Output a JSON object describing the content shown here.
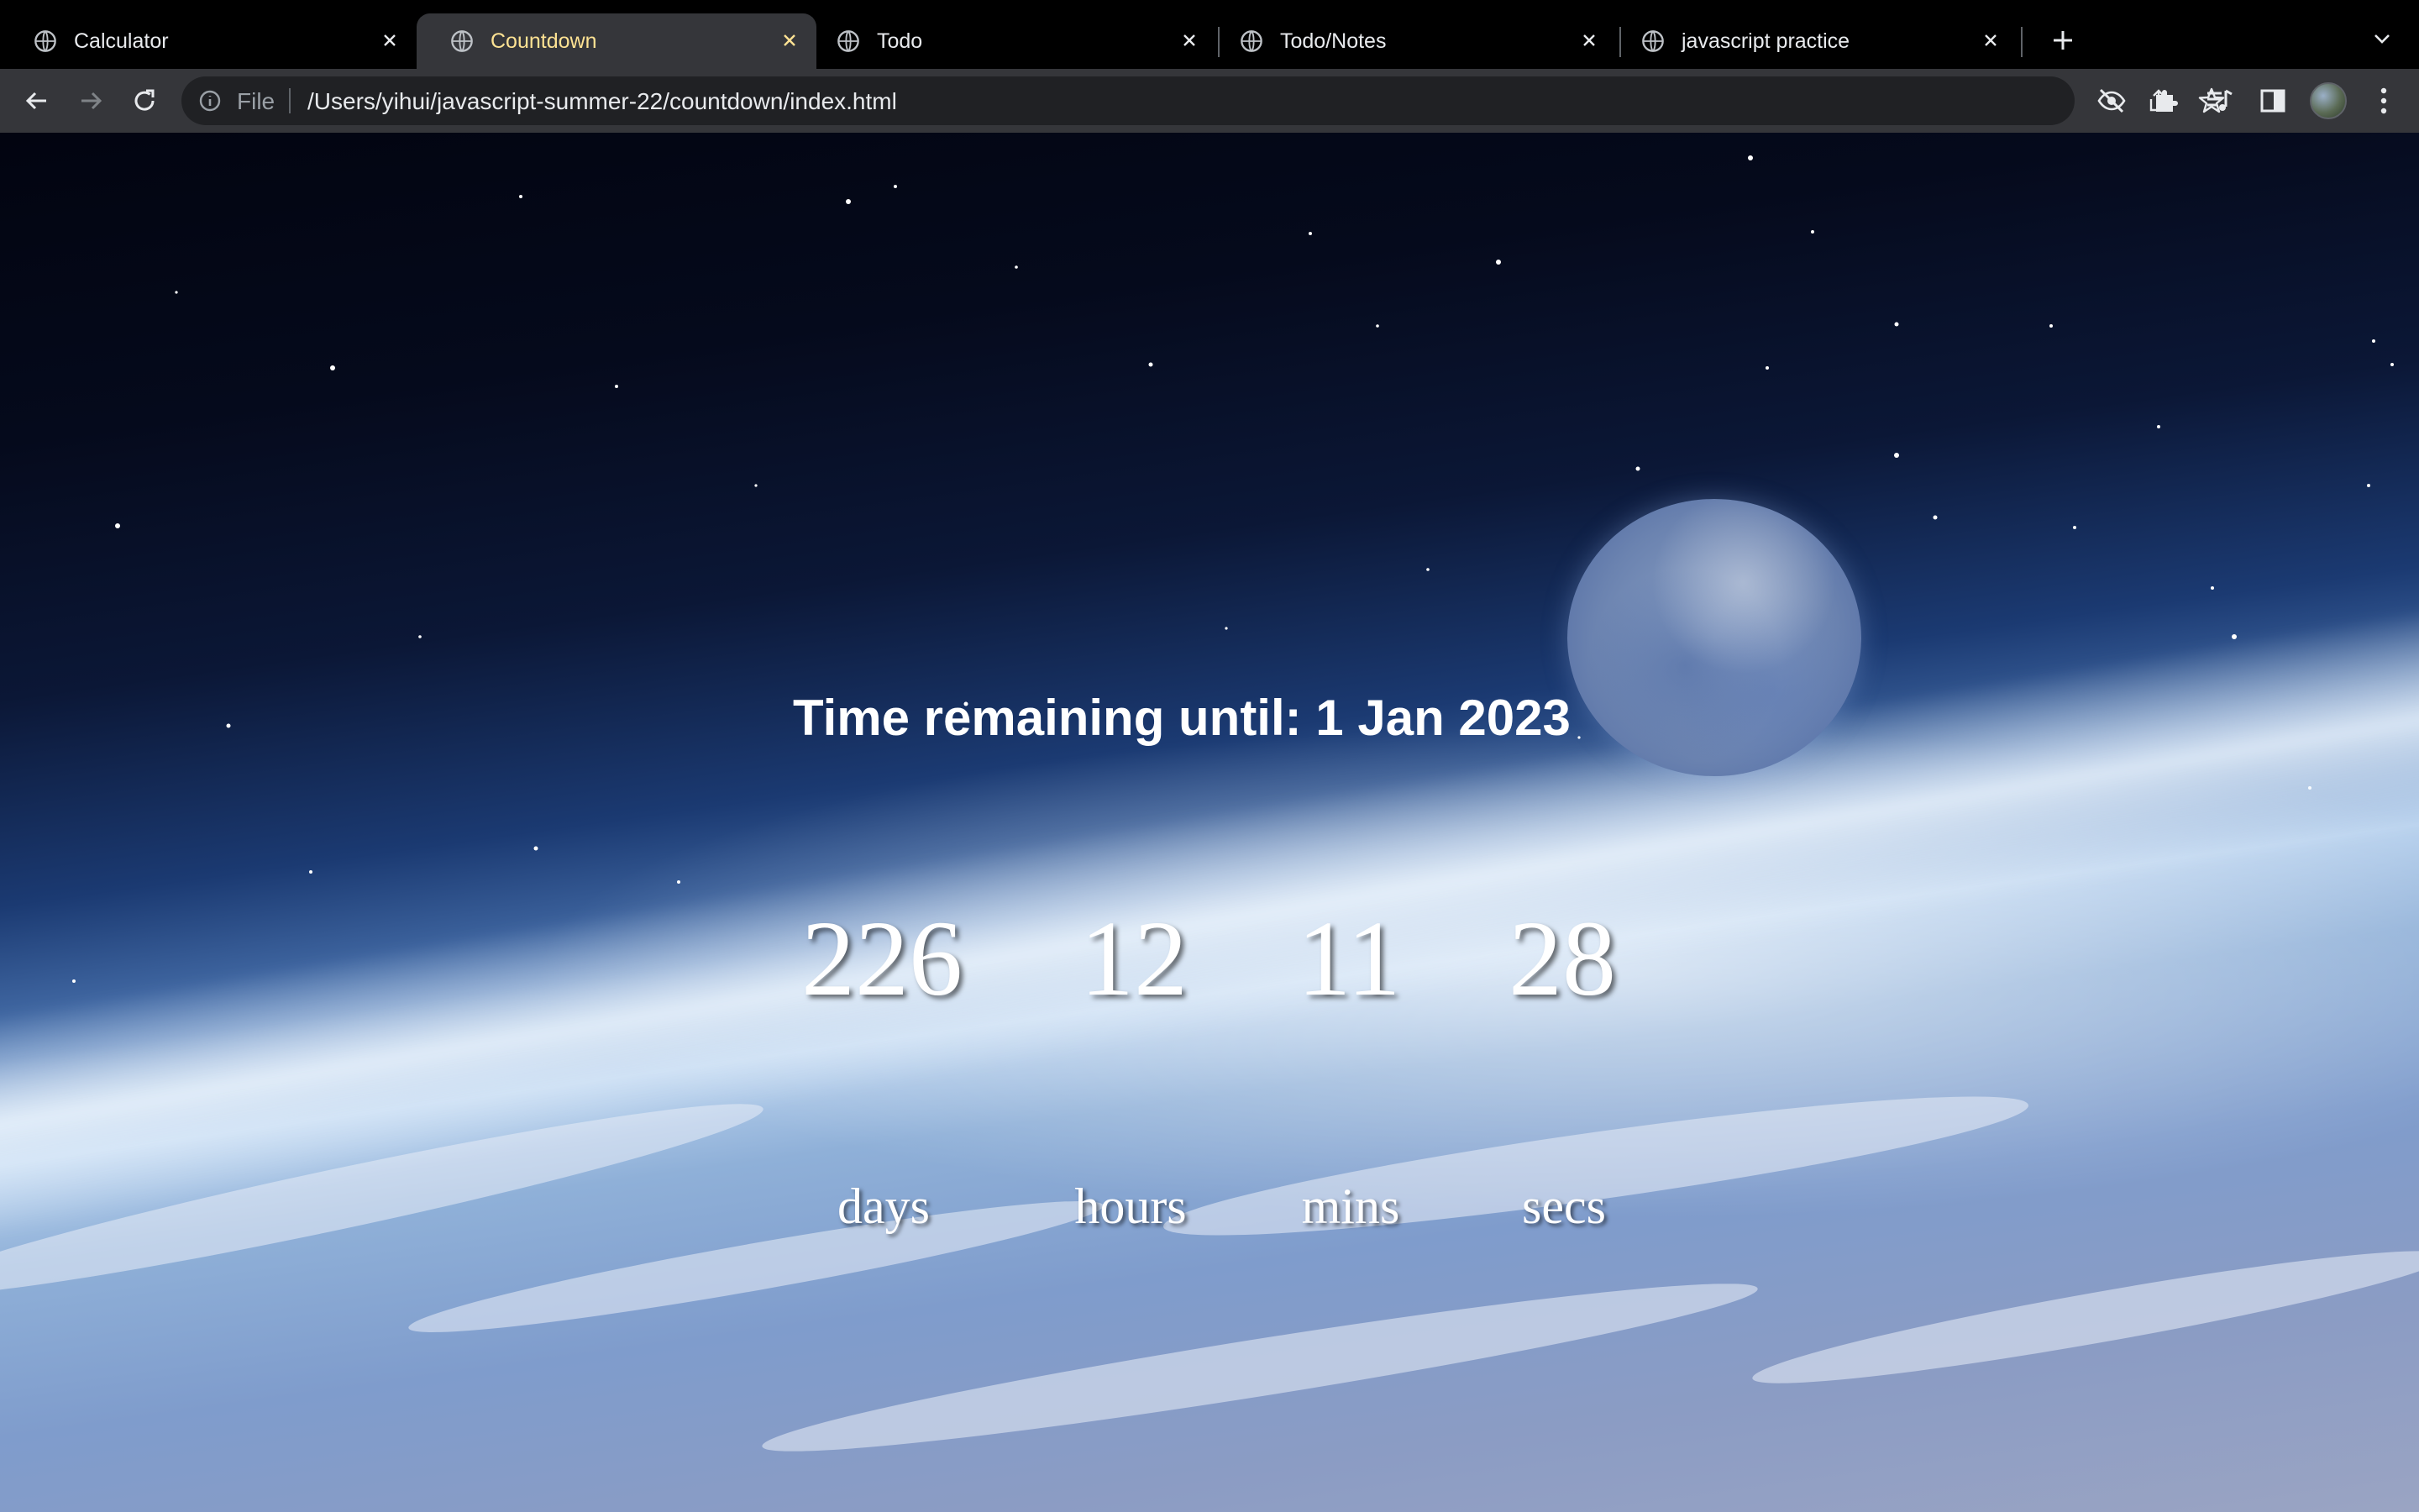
{
  "browser": {
    "tabs": [
      {
        "title": "Calculator",
        "active": false
      },
      {
        "title": "Countdown",
        "active": true
      },
      {
        "title": "Todo",
        "active": false
      },
      {
        "title": "Todo/Notes",
        "active": false
      },
      {
        "title": "javascript practice",
        "active": false
      }
    ],
    "address_bar": {
      "scheme_label": "File",
      "url": "/Users/yihui/javascript-summer-22/countdown/index.html"
    },
    "colors": {
      "active_tab_title": "#fde293",
      "toolbar": "#35363a",
      "omnibox": "#202124"
    }
  },
  "page": {
    "heading": "Time remaining until: 1 Jan 2023",
    "countdown": [
      {
        "value": "226",
        "unit": "days"
      },
      {
        "value": "12",
        "unit": "hours"
      },
      {
        "value": "11",
        "unit": "mins"
      },
      {
        "value": "28",
        "unit": "secs"
      }
    ]
  }
}
